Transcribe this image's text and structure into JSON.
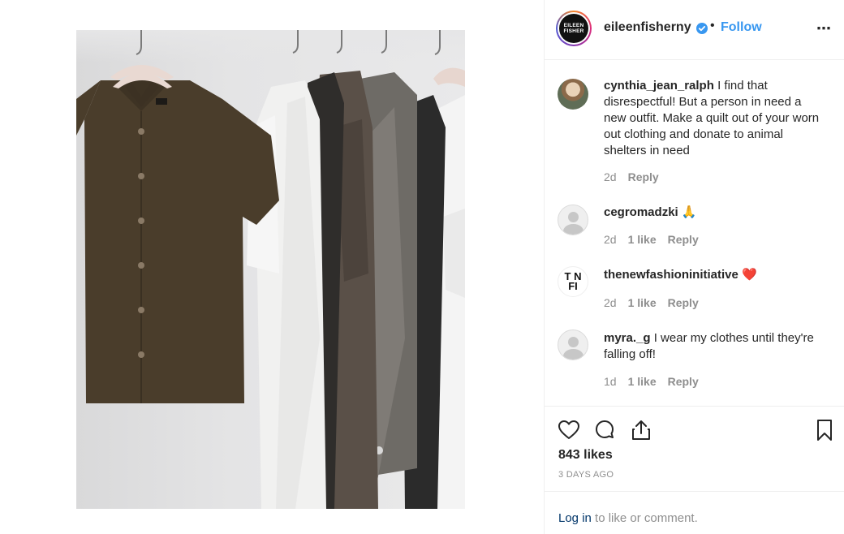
{
  "post": {
    "image_alt": "Clothes hanging on a rack: olive short-sleeve shirt, white linen shirts, grey and black garments"
  },
  "header": {
    "username": "eileenfisherny",
    "logo_text": "EILEEN FISHER",
    "separator": "•",
    "follow_label": "Follow",
    "more_label": "⋯"
  },
  "comments": [
    {
      "username": "cynthia_jean_ralph",
      "text": "I find that disrespectful! But a person in need a new outfit. Make a quilt out of your worn out clothing and donate to animal shelters in need",
      "age": "2d",
      "likes": "",
      "reply": "Reply"
    },
    {
      "username": "cegromadzki",
      "text": "🙏",
      "age": "2d",
      "likes": "1 like",
      "reply": "Reply"
    },
    {
      "username": "thenewfashioninitiative",
      "avatar_text": "T N\nFI",
      "text": "❤️",
      "age": "2d",
      "likes": "1 like",
      "reply": "Reply"
    },
    {
      "username": "myra._g",
      "text": "I wear my clothes until they're falling off!",
      "age": "1d",
      "likes": "1 like",
      "reply": "Reply"
    }
  ],
  "actions": {
    "likes_count": "843 likes",
    "date": "3 DAYS AGO",
    "icons": [
      "heart-icon",
      "comment-icon",
      "share-icon",
      "bookmark-icon"
    ]
  },
  "footer": {
    "login_label": "Log in",
    "suffix": "to like or comment."
  },
  "colors": {
    "accent": "#3897f0",
    "verified": "#3897f0",
    "muted": "#8e8e8e",
    "text": "#262626",
    "border": "#efefef",
    "heart": "#ed4956"
  }
}
